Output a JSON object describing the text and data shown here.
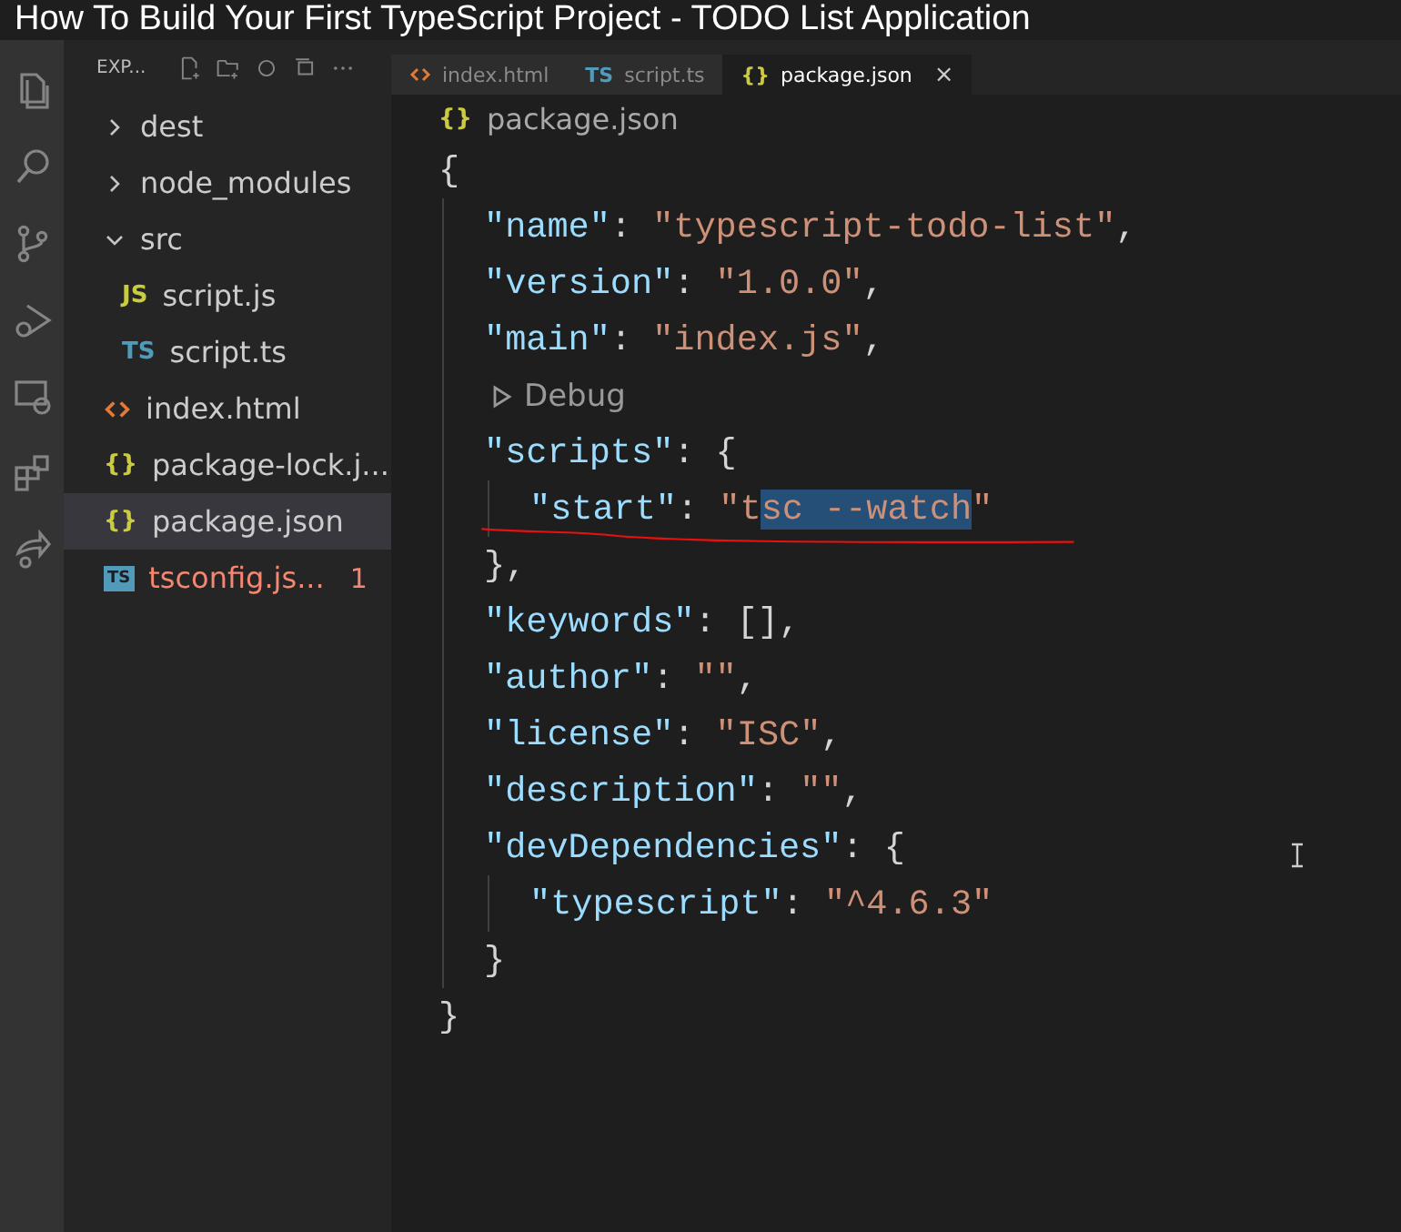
{
  "video_title": "How To Build Your First TypeScript Project - TODO List Application",
  "explorer": {
    "title": "EXP...",
    "tree": [
      {
        "label": "dest",
        "kind": "folder",
        "expanded": false,
        "selected": false
      },
      {
        "label": "node_modules",
        "kind": "folder",
        "expanded": false,
        "selected": false
      },
      {
        "label": "src",
        "kind": "folder",
        "expanded": true,
        "selected": false,
        "children": [
          {
            "label": "script.js",
            "kind": "js",
            "icon": "JS",
            "selected": false
          },
          {
            "label": "script.ts",
            "kind": "ts",
            "icon": "TS",
            "selected": false
          }
        ]
      },
      {
        "label": "index.html",
        "kind": "html",
        "selected": false
      },
      {
        "label": "package-lock.j...",
        "kind": "json",
        "icon": "{}",
        "selected": false
      },
      {
        "label": "package.json",
        "kind": "json",
        "icon": "{}",
        "selected": true
      },
      {
        "label": "tsconfig.js...",
        "kind": "tsconfig",
        "icon": "TS",
        "selected": false,
        "error": true,
        "badge": "1"
      }
    ]
  },
  "tabs": [
    {
      "label": "index.html",
      "kind": "html",
      "selected": false
    },
    {
      "label": "script.ts",
      "kind": "ts",
      "icon": "TS",
      "selected": false
    },
    {
      "label": "package.json",
      "kind": "json",
      "icon": "{}",
      "selected": true,
      "close": "×"
    }
  ],
  "breadcrumb": {
    "icon": "{}",
    "label": "package.json"
  },
  "code": [
    {
      "tokens": [
        {
          "kind": "punct",
          "text": "{"
        }
      ],
      "children": [
        {
          "tokens": [
            {
              "kind": "key",
              "text": "\"name\""
            },
            {
              "kind": "punct",
              "text": ": "
            },
            {
              "kind": "string",
              "text": "\"typescript-todo-list\""
            },
            {
              "kind": "punct",
              "text": ","
            }
          ]
        },
        {
          "tokens": [
            {
              "kind": "key",
              "text": "\"version\""
            },
            {
              "kind": "punct",
              "text": ": "
            },
            {
              "kind": "string",
              "text": "\"1.0.0\""
            },
            {
              "kind": "punct",
              "text": ","
            }
          ]
        },
        {
          "tokens": [
            {
              "kind": "key",
              "text": "\"main\""
            },
            {
              "kind": "punct",
              "text": ": "
            },
            {
              "kind": "string",
              "text": "\"index.js\""
            },
            {
              "kind": "punct",
              "text": ","
            }
          ]
        },
        {
          "kind": "codelens",
          "tokens": [
            {
              "kind": "lens",
              "text": "Debug"
            }
          ]
        },
        {
          "tokens": [
            {
              "kind": "key",
              "text": "\"scripts\""
            },
            {
              "kind": "punct",
              "text": ": {"
            }
          ],
          "children": [
            {
              "tokens": [
                {
                  "kind": "key",
                  "text": "\"start\""
                },
                {
                  "kind": "punct",
                  "text": ": "
                },
                {
                  "kind": "string",
                  "text": "\"t"
                },
                {
                  "kind": "selected",
                  "text": "sc --watch"
                },
                {
                  "kind": "string",
                  "text": "\""
                }
              ]
            }
          ]
        },
        {
          "tokens": [
            {
              "kind": "punct",
              "text": "},"
            }
          ]
        },
        {
          "tokens": [
            {
              "kind": "key",
              "text": "\"keywords\""
            },
            {
              "kind": "punct",
              "text": ": [],"
            }
          ]
        },
        {
          "tokens": [
            {
              "kind": "key",
              "text": "\"author\""
            },
            {
              "kind": "punct",
              "text": ": "
            },
            {
              "kind": "string",
              "text": "\"\""
            },
            {
              "kind": "punct",
              "text": ","
            }
          ]
        },
        {
          "tokens": [
            {
              "kind": "key",
              "text": "\"license\""
            },
            {
              "kind": "punct",
              "text": ": "
            },
            {
              "kind": "string",
              "text": "\"ISC\""
            },
            {
              "kind": "punct",
              "text": ","
            }
          ]
        },
        {
          "tokens": [
            {
              "kind": "key",
              "text": "\"description\""
            },
            {
              "kind": "punct",
              "text": ": "
            },
            {
              "kind": "string",
              "text": "\"\""
            },
            {
              "kind": "punct",
              "text": ","
            }
          ]
        },
        {
          "tokens": [
            {
              "kind": "key",
              "text": "\"devDependencies\""
            },
            {
              "kind": "punct",
              "text": ": {"
            }
          ],
          "children": [
            {
              "tokens": [
                {
                  "kind": "key",
                  "text": "\"typescript\""
                },
                {
                  "kind": "punct",
                  "text": ": "
                },
                {
                  "kind": "string",
                  "text": "\"^4.6.3\""
                }
              ]
            }
          ]
        },
        {
          "tokens": [
            {
              "kind": "punct",
              "text": "}"
            }
          ]
        }
      ]
    },
    {
      "tokens": [
        {
          "kind": "punct",
          "text": "}"
        }
      ]
    }
  ]
}
